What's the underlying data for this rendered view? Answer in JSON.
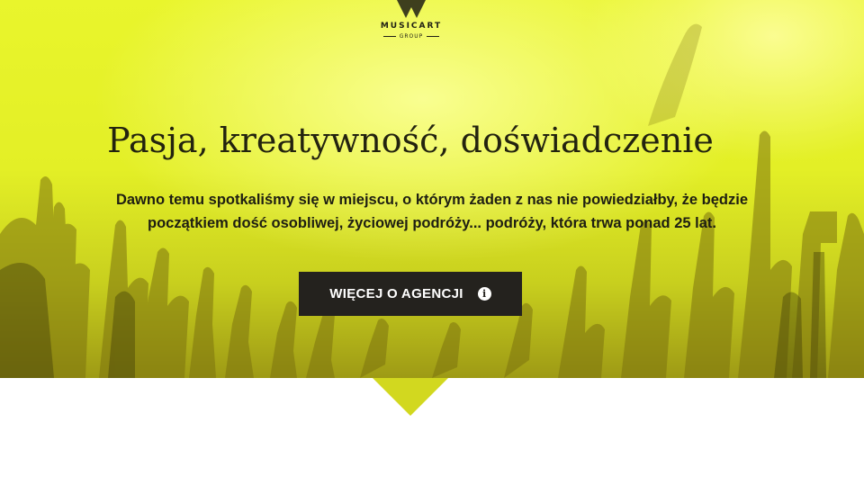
{
  "brand": {
    "name": "MUSICART",
    "sub": "GROUP"
  },
  "hero": {
    "title": "Pasja, kreatywność, doświadczenie",
    "lead_line1": "Dawno temu spotkaliśmy się w miejscu, o którym żaden z nas nie powiedziałby, że będzie",
    "lead_line2": "początkiem dość osobliwej, życiowej podróży... podróży, która trwa ponad 25 lat.",
    "button_label": "WIĘCEJ O AGENCJI",
    "button_icon": "info-icon"
  },
  "colors": {
    "hero_yellow": "#e6f22a",
    "button_bg": "#24221e",
    "text_dark": "#1e1e12"
  }
}
